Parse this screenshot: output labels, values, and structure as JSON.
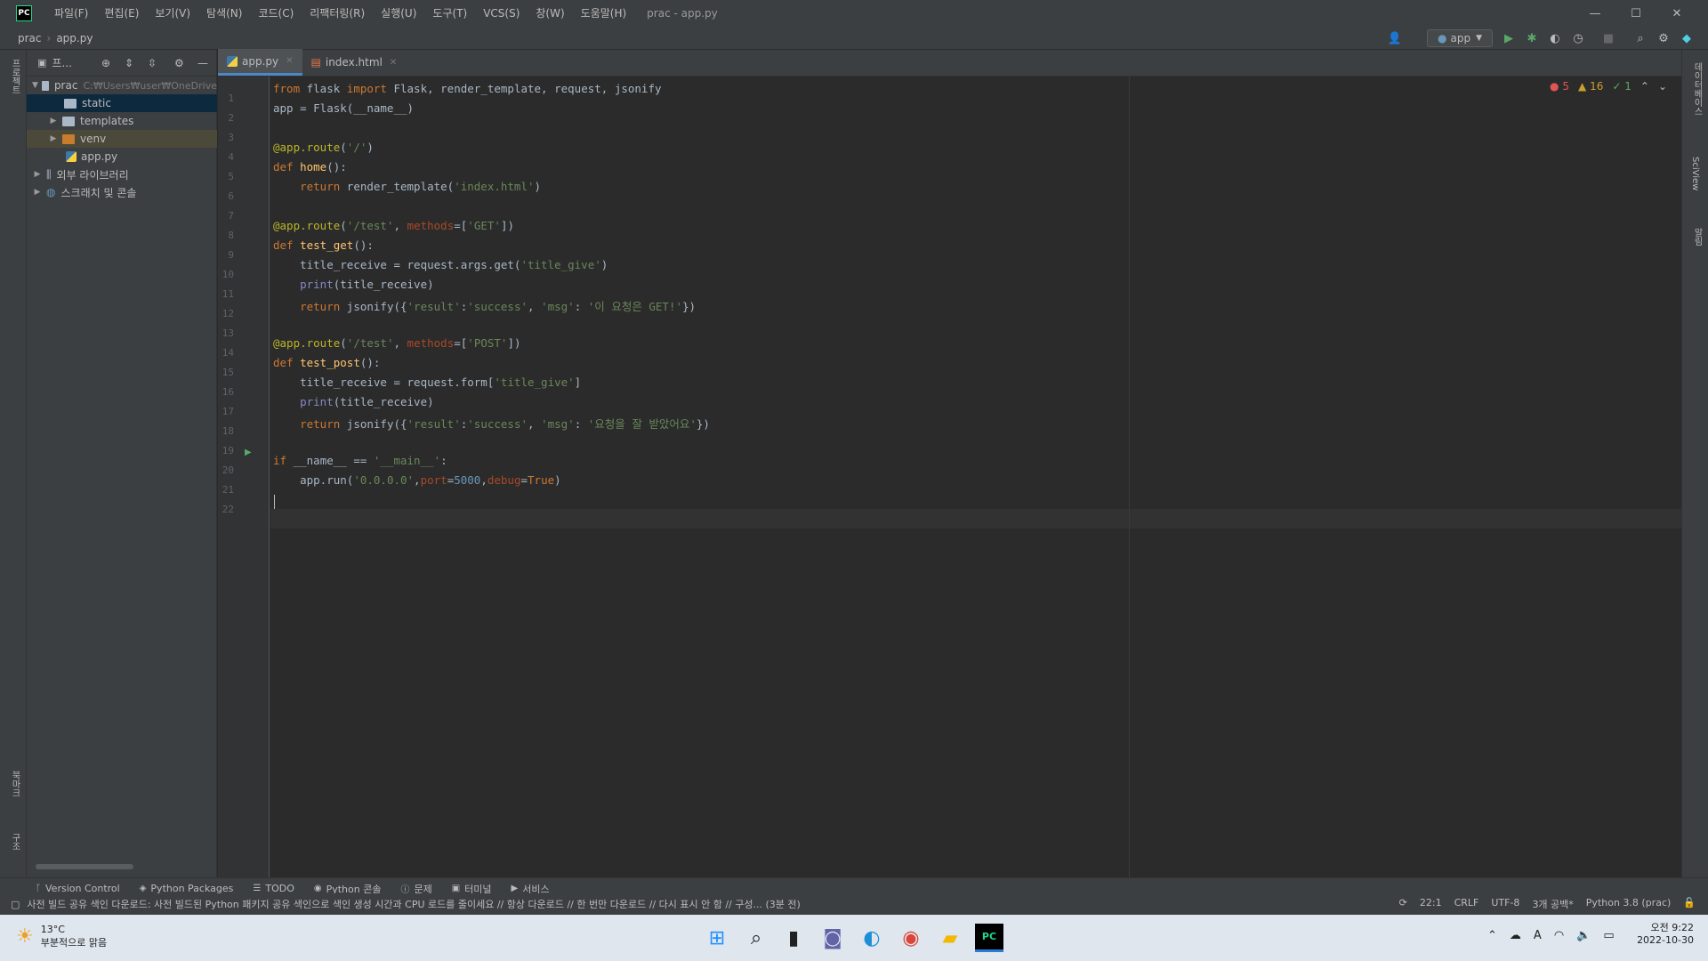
{
  "titlebar": {
    "logo": "PC",
    "menu": [
      "파일(F)",
      "편집(E)",
      "보기(V)",
      "탐색(N)",
      "코드(C)",
      "리팩터링(R)",
      "실행(U)",
      "도구(T)",
      "VCS(S)",
      "창(W)",
      "도움말(H)"
    ],
    "window_title": "prac - app.py"
  },
  "navbar": {
    "project": "prac",
    "file": "app.py",
    "run_config": "app"
  },
  "left_stripe": {
    "project_label": "프로젝트",
    "bookmarks_label": "북마크",
    "structure_label": "구조"
  },
  "right_stripe": {
    "database_label": "데이터베이스",
    "sciview_label": "SciView",
    "notifications_label": "알림"
  },
  "project_panel": {
    "title": "프...",
    "root_name": "prac",
    "root_path": "C:₩Users₩user₩OneDrive",
    "items": [
      "static",
      "templates",
      "venv",
      "app.py",
      "외부 라이브러리",
      "스크래치 및 콘솔"
    ]
  },
  "tabs": [
    {
      "label": "app.py"
    },
    {
      "label": "index.html"
    }
  ],
  "inspections": {
    "errors": "5",
    "warnings": "16",
    "ok": "1"
  },
  "code": {
    "line_numbers": [
      "1",
      "2",
      "3",
      "4",
      "5",
      "6",
      "7",
      "8",
      "9",
      "10",
      "11",
      "12",
      "13",
      "14",
      "15",
      "16",
      "17",
      "18",
      "19",
      "20",
      "21",
      "22"
    ],
    "lines": [
      "from flask import Flask, render_template, request, jsonify",
      "app = Flask(__name__)",
      "",
      "@app.route('/')",
      "def home():",
      "    return render_template('index.html')",
      "",
      "@app.route('/test', methods=['GET'])",
      "def test_get():",
      "    title_receive = request.args.get('title_give')",
      "    print(title_receive)",
      "    return jsonify({'result':'success', 'msg': '이 요청은 GET!'})",
      "",
      "@app.route('/test', methods=['POST'])",
      "def test_post():",
      "    title_receive = request.form['title_give']",
      "    print(title_receive)",
      "    return jsonify({'result':'success', 'msg': '요청을 잘 받았어요'})",
      "",
      "if __name__ == '__main__':",
      "    app.run('0.0.0.0',port=5000,debug=True)",
      ""
    ]
  },
  "bottom_tools": [
    "Version Control",
    "Python Packages",
    "TODO",
    "Python 콘솔",
    "문제",
    "터미널",
    "서비스"
  ],
  "statusbar": {
    "message": "사전 빌드 공유 색인 다운로드: 사전 빌드된 Python 패키지 공유 색인으로 색인 생성 시간과 CPU 로드를 줄이세요 // 항상 다운로드 // 한 번만 다운로드 // 다시 표시 안 함 // 구성... (3분 전)",
    "position": "22:1",
    "line_sep": "CRLF",
    "encoding": "UTF-8",
    "indent": "3개 공백*",
    "interpreter": "Python 3.8 (prac)"
  },
  "taskbar": {
    "weather_temp": "13°C",
    "weather_desc": "부분적으로 맑음",
    "ime": "A",
    "time": "오전 9:22",
    "date": "2022-10-30"
  }
}
